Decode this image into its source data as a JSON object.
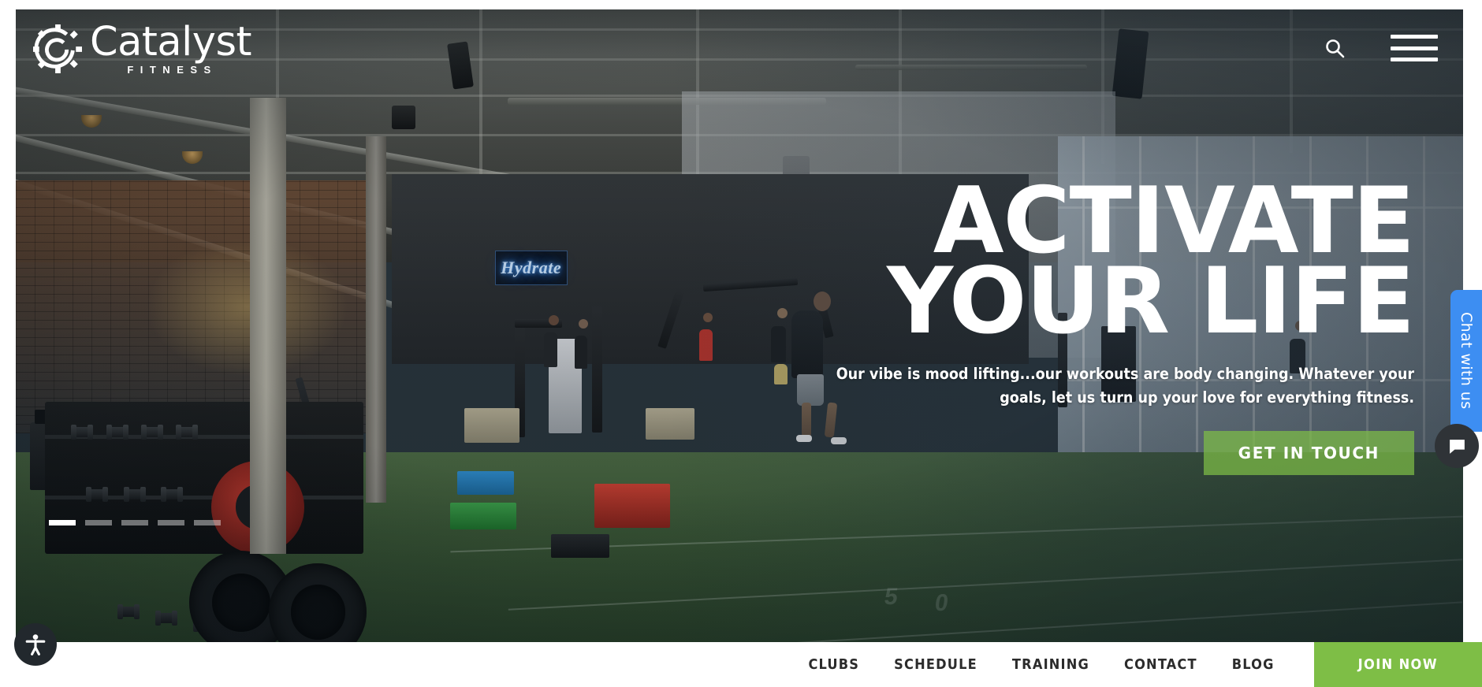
{
  "brand": {
    "name": "Catalyst",
    "tagline": "FITNESS",
    "logo_icon": "catalyst-gear-c-icon",
    "accent_green": "#7ebe46",
    "chat_blue": "#3d8ef2"
  },
  "header": {
    "search_icon": "search-icon",
    "menu_icon": "hamburger-menu-icon"
  },
  "hero": {
    "title_line1": "ACTIVATE",
    "title_line2": "YOUR LIFE",
    "subtitle": "Our vibe is mood lifting...our workouts are body changing. Whatever your goals, let us turn up your love for everything fitness.",
    "cta_label": "GET IN TOUCH",
    "neon_sign_text": "Hydrate",
    "slides": [
      {
        "active": true
      },
      {
        "active": false
      },
      {
        "active": false
      },
      {
        "active": false
      },
      {
        "active": false
      }
    ]
  },
  "bottom_nav": {
    "items": [
      {
        "label": "CLUBS"
      },
      {
        "label": "SCHEDULE"
      },
      {
        "label": "TRAINING"
      },
      {
        "label": "CONTACT"
      },
      {
        "label": "BLOG"
      }
    ],
    "join_label": "JOIN NOW"
  },
  "chat": {
    "tab_label": "Chat with us",
    "bubble_icon": "chat-bubble-icon"
  },
  "accessibility": {
    "icon": "accessibility-person-icon"
  }
}
